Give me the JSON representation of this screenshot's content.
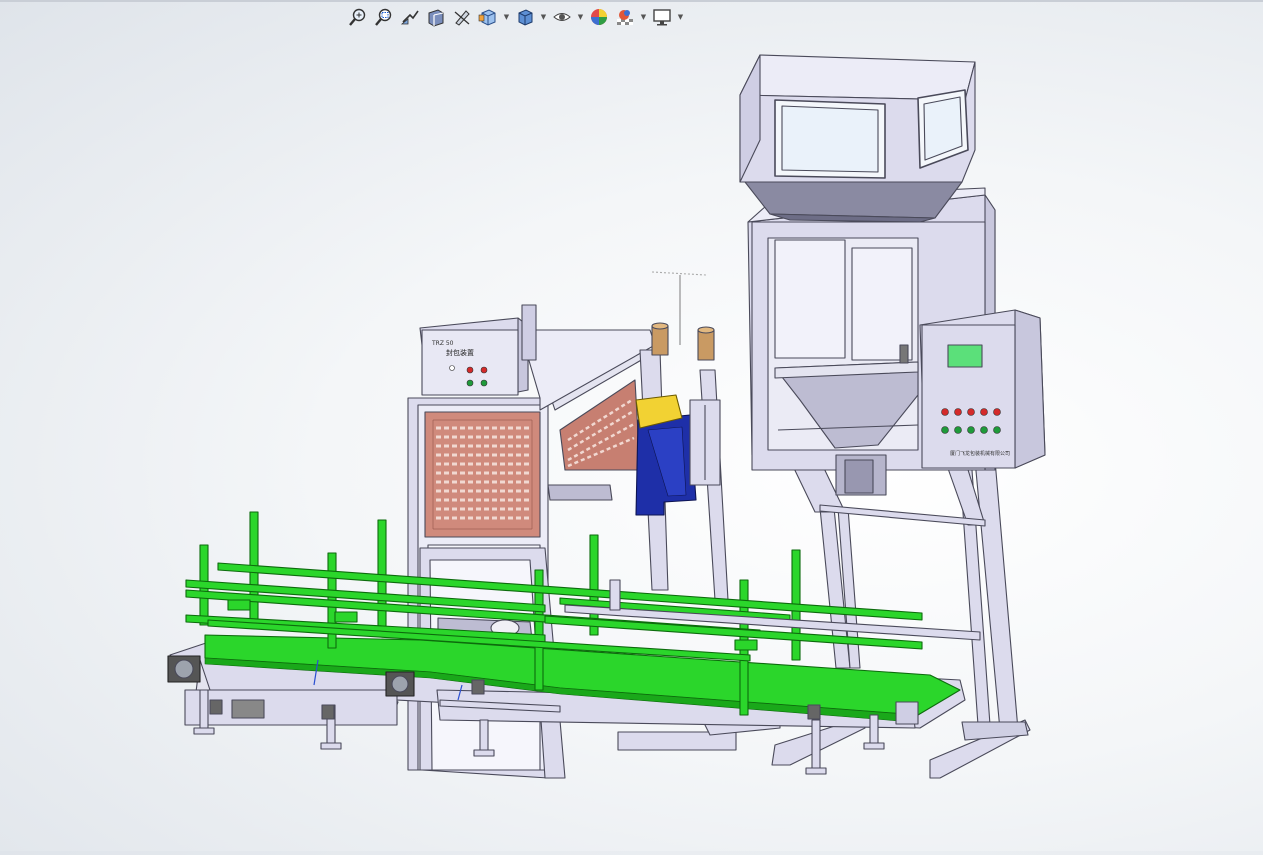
{
  "app": "SolidWorks",
  "heads_up_toolbar": [
    {
      "name": "zoom-to-fit-icon",
      "dropdown": false
    },
    {
      "name": "zoom-to-area-icon",
      "dropdown": false
    },
    {
      "name": "previous-view-icon",
      "dropdown": false
    },
    {
      "name": "section-view-icon",
      "dropdown": false
    },
    {
      "name": "dynamic-annotation-icon",
      "dropdown": false
    },
    {
      "name": "view-orientation-icon",
      "dropdown": true
    },
    {
      "name": "display-style-icon",
      "dropdown": true
    },
    {
      "name": "hide-show-items-icon",
      "dropdown": true
    },
    {
      "name": "edit-appearance-icon",
      "dropdown": false
    },
    {
      "name": "apply-scene-icon",
      "dropdown": true
    },
    {
      "name": "view-settings-icon",
      "dropdown": true
    }
  ],
  "model": {
    "sealer_panel_label": "TRZ 50",
    "sealer_panel_title": "封包装置",
    "control_panel_label": "厦门飞龙包装机械有限公司"
  },
  "colors": {
    "frame": "#dcdbed",
    "frame_stroke": "#4a4a5a",
    "conveyor_green": "#2bd62b",
    "guard_panel": "#d08a7c",
    "sewing_head_blue": "#1e2fa8",
    "sewing_head_yellow": "#f2d233",
    "hmi_screen": "#5be07a"
  }
}
